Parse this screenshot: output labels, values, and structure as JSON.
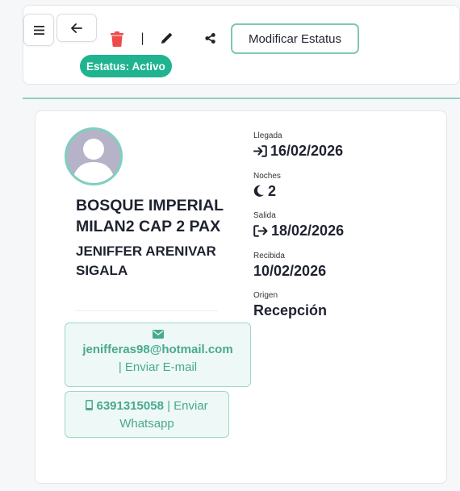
{
  "toolbar": {
    "menu_icon": "hamburger-menu-icon",
    "back_icon": "arrow-left-icon",
    "delete_icon": "trash-icon",
    "separator": "|",
    "edit_icon": "pencil-icon",
    "share_icon": "share-icon",
    "status_button_label": "Modificar Estatus",
    "status_badge": "Estatus: Activo"
  },
  "colors": {
    "accent": "#1fb48f",
    "accent_border": "#7fc7b5",
    "contact_text": "#48a98f",
    "delete": "#ef4b4b"
  },
  "reservation": {
    "room": "BOSQUE IMPERIAL MILAN2 CAP 2 PAX",
    "guest": "JENIFFER ARENIVAR SIGALA",
    "email": "jenifferas98@hotmail.com",
    "email_action": "| Enviar E-mail",
    "phone": "6391315058",
    "whatsapp_action": "| Enviar Whatsapp",
    "details": {
      "arrival_label": "Llegada",
      "arrival_value": "16/02/2026",
      "nights_label": "Noches",
      "nights_value": "2",
      "departure_label": "Salida",
      "departure_value": "18/02/2026",
      "received_label": "Recibida",
      "received_value": "10/02/2026",
      "origin_label": "Origen",
      "origin_value": "Recepción"
    }
  }
}
